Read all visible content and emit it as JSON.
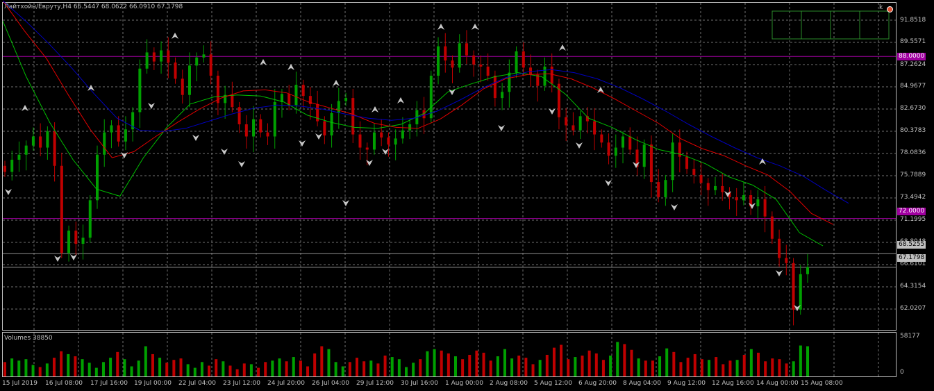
{
  "header": {
    "symbol": "Лайтхойн/Евруту,H4",
    "ohlc": "66.5447 68.0622 66.0910 67.1798"
  },
  "volume_header": "Volumes 38850",
  "price_axis": [
    "91.8518",
    "89.5571",
    "87.2624",
    "84.9677",
    "82.6730",
    "80.3783",
    "78.0836",
    "75.7889",
    "73.4942",
    "71.1995",
    "68.8048",
    "66.6101",
    "64.3154",
    "62.0207"
  ],
  "volume_axis": [
    "58177",
    "0"
  ],
  "time_axis": [
    "15 Jul 2019",
    "16 Jul 08:00",
    "17 Jul 16:00",
    "19 Jul 00:00",
    "22 Jul 04:00",
    "23 Jul 12:00",
    "24 Jul 20:00",
    "26 Jul 04:00",
    "29 Jul 12:00",
    "30 Jul 16:00",
    "1 Aug 00:00",
    "2 Aug 08:00",
    "5 Aug 12:00",
    "6 Aug 20:00",
    "8 Aug 04:00",
    "9 Aug 12:00",
    "12 Aug 16:00",
    "14 Aug 00:00",
    "15 Aug 08:00"
  ],
  "levels": [
    {
      "label": "88.0000",
      "color": "#a000a0"
    },
    {
      "label": "72.0000",
      "color": "#a000a0"
    },
    {
      "label": "68.5255",
      "color": "#c0c0c0"
    },
    {
      "label": "67.1798",
      "color": "#c0c0c0"
    }
  ],
  "corner_label": "k",
  "colors": {
    "bull": "#00a000",
    "bear": "#c00000",
    "ma_fast": "#00c000",
    "ma_mid": "#e00000",
    "ma_slow": "#0000c0",
    "grid": "#707070"
  },
  "chart_data": {
    "type": "candlestick",
    "symbol": "Лайтхойн/Евруту",
    "timeframe": "H4",
    "ylim": [
      61.0,
      93.3
    ],
    "levels": [
      88.0,
      72.0,
      68.5255,
      67.1798
    ],
    "candles_close": [
      76.6,
      77.8,
      78.3,
      79.2,
      80.1,
      79.0,
      80.6,
      77.2,
      68.6,
      70.8,
      69.5,
      70.1,
      73.8,
      78.3,
      80.5,
      81.2,
      79.6,
      80.8,
      82.5,
      86.8,
      88.4,
      87.5,
      88.6,
      87.4,
      85.8,
      84.2,
      87.1,
      87.9,
      88.2,
      86.1,
      83.4,
      84.2,
      83.0,
      81.3,
      80.1,
      81.8,
      80.5,
      80.1,
      83.5,
      84.3,
      83.2,
      85.2,
      84.1,
      83.3,
      81.6,
      80.2,
      82.4,
      83.6,
      83.9,
      80.3,
      79.0,
      78.8,
      80.5,
      80.0,
      79.3,
      79.9,
      80.7,
      81.3,
      82.7,
      81.9,
      86.1,
      89.0,
      87.6,
      86.9,
      89.3,
      88.1,
      87.2,
      87.0,
      86.1,
      83.9,
      84.5,
      86.4,
      88.5,
      86.9,
      86.2,
      85.1,
      87.0,
      85.3,
      82.0,
      81.2,
      80.7,
      82.1,
      81.6,
      80.3,
      79.5,
      78.2,
      79.0,
      80.1,
      78.8,
      77.1,
      79.3,
      75.6,
      74.1,
      75.8,
      79.5,
      78.1,
      76.9,
      76.3,
      75.5,
      74.8,
      75.2,
      74.6,
      74.1,
      73.8,
      74.3,
      73.2,
      73.9,
      72.2,
      70.0,
      68.1,
      67.6,
      63.0,
      66.5,
      67.2
    ],
    "moving_averages": [
      {
        "color": "#00c000",
        "values": [
          91.5,
          86.0,
          81.5,
          77.8,
          74.9,
          74.2,
          78.0,
          81.0,
          83.3,
          84.0,
          84.2,
          84.1,
          83.5,
          82.2,
          81.5,
          81.0,
          80.9,
          81.3,
          82.4,
          84.5,
          85.3,
          86.0,
          86.4,
          86.0,
          84.3,
          81.9,
          81.0,
          79.8,
          78.8,
          78.3,
          77.4,
          76.1,
          75.3,
          73.9,
          70.6,
          69.3
        ]
      },
      {
        "color": "#e00000",
        "values": [
          93.5,
          90.5,
          87.8,
          84.2,
          80.8,
          78.0,
          78.6,
          80.1,
          81.5,
          82.8,
          83.9,
          84.6,
          84.7,
          84.4,
          83.5,
          82.9,
          82.3,
          81.4,
          81.0,
          80.9,
          81.8,
          83.2,
          84.8,
          85.8,
          86.2,
          86.3,
          85.8,
          84.9,
          83.8,
          82.6,
          81.4,
          79.9,
          78.9,
          78.2,
          77.2,
          76.3,
          74.7,
          72.5,
          71.4
        ]
      },
      {
        "color": "#0000c0",
        "values": [
          93.5,
          91.5,
          89.3,
          86.9,
          84.3,
          81.9,
          80.7,
          80.6,
          80.9,
          81.6,
          82.3,
          82.9,
          83.2,
          83.1,
          82.8,
          82.3,
          81.9,
          81.7,
          81.9,
          82.6,
          83.7,
          84.9,
          85.9,
          86.5,
          86.7,
          86.4,
          85.8,
          84.9,
          83.8,
          82.6,
          81.3,
          80.1,
          79.0,
          78.0,
          77.2,
          76.2,
          74.8,
          73.5
        ]
      }
    ],
    "volumes": [
      20,
      25,
      22,
      24,
      16,
      13,
      18,
      26,
      35,
      31,
      28,
      24,
      19,
      12,
      20,
      26,
      34,
      24,
      14,
      22,
      42,
      31,
      26,
      19,
      23,
      25,
      17,
      12,
      20,
      15,
      24,
      21,
      15,
      10,
      18,
      17,
      12,
      20,
      22,
      25,
      21,
      27,
      22,
      14,
      32,
      42,
      38,
      20,
      14,
      20,
      26,
      21,
      22,
      18,
      29,
      27,
      24,
      13,
      19,
      24,
      35,
      38,
      36,
      32,
      28,
      24,
      30,
      36,
      33,
      22,
      28,
      38,
      25,
      29,
      26,
      17,
      23,
      30,
      40,
      44,
      24,
      27,
      29,
      36,
      32,
      23,
      29,
      48,
      45,
      37,
      25,
      22,
      22,
      28,
      39,
      34,
      20,
      26,
      31,
      24,
      23,
      27,
      17,
      22,
      23,
      30,
      38,
      33,
      21,
      25,
      24,
      18,
      21,
      43,
      42
    ]
  }
}
